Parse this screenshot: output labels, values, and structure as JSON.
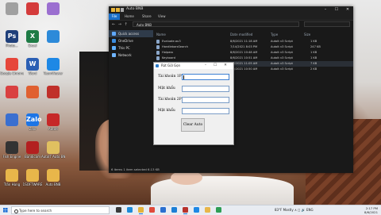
{
  "desktop": {
    "icons": [
      {
        "name": "icon-1",
        "label": "",
        "glyph": "",
        "color": "#a0a0a0"
      },
      {
        "name": "icon-2",
        "label": "",
        "glyph": "",
        "color": "#d43b3b"
      },
      {
        "name": "icon-3",
        "label": "",
        "glyph": "",
        "color": "#9b6fd0"
      },
      {
        "name": "photoshop",
        "label": "Photo...",
        "glyph": "Ps",
        "color": "#1f3f7a"
      },
      {
        "name": "excel",
        "label": "Excel",
        "glyph": "X",
        "color": "#1e7b45"
      },
      {
        "name": "app-blue",
        "label": "",
        "glyph": "",
        "color": "#2d8ad9"
      },
      {
        "name": "chrome",
        "label": "Google Chrome",
        "glyph": "",
        "color": "#e6463a"
      },
      {
        "name": "word",
        "label": "Word",
        "glyph": "W",
        "color": "#2b5fb4"
      },
      {
        "name": "teamviewer",
        "label": "TeamViewer",
        "glyph": "",
        "color": "#1e88e5"
      },
      {
        "name": "app-red-1",
        "label": "",
        "glyph": "",
        "color": "#d94040"
      },
      {
        "name": "app-red-2",
        "label": "",
        "glyph": "",
        "color": "#e06030"
      },
      {
        "name": "app-red-3",
        "label": "",
        "glyph": "",
        "color": "#c0302a"
      },
      {
        "name": "app-4",
        "label": "",
        "glyph": "",
        "color": "#3a6fd0"
      },
      {
        "name": "zalo",
        "label": "Zalo",
        "glyph": "Zalo",
        "color": "#1d75e6"
      },
      {
        "name": "autoit",
        "label": "AutoIt",
        "glyph": "",
        "color": "#c62828"
      },
      {
        "name": "game",
        "label": "Fish Engine",
        "glyph": "",
        "color": "#333"
      },
      {
        "name": "bandicam",
        "label": "Bandicam",
        "glyph": "",
        "color": "#b32020"
      },
      {
        "name": "autoit-folder",
        "label": "AutoIT Auto BNB",
        "glyph": "",
        "color": "#e0c060"
      },
      {
        "name": "folder-1",
        "label": "Trần Hùng",
        "glyph": "",
        "color": "#e8b64a"
      },
      {
        "name": "folder-2",
        "label": "1SOFTWARE",
        "glyph": "",
        "color": "#e8b64a"
      },
      {
        "name": "folder-3",
        "label": "Auto BNB",
        "glyph": "",
        "color": "#e8b64a"
      }
    ]
  },
  "explorer": {
    "title": "Auto BNB",
    "ribbon": [
      "File",
      "Home",
      "Share",
      "View"
    ],
    "path": "Auto BNB",
    "nav_items": [
      {
        "label": "Quick access",
        "color": "#5fa8ff",
        "selected": true
      },
      {
        "label": "OneDrive",
        "color": "#3b8de0",
        "selected": false
      },
      {
        "label": "This PC",
        "color": "#5fb0ff",
        "selected": false
      },
      {
        "label": "Network",
        "color": "#6fb5ff",
        "selected": false
      }
    ],
    "columns": [
      "Name",
      "Date modified",
      "Type",
      "Size"
    ],
    "files": [
      {
        "name": "Evaluate.au3",
        "date": "8/6/2021 11:18 AM",
        "type": "AutoIt v3 Script",
        "size": "1 KB"
      },
      {
        "name": "HandlebarsSearch",
        "date": "7/14/2021 8:03 PM",
        "type": "AutoIt v3 Script",
        "size": "247 KB"
      },
      {
        "name": "Hoipass",
        "date": "8/6/2021 10:48 AM",
        "type": "AutoIt v3 Script",
        "size": "1 KB"
      },
      {
        "name": "Keyboard",
        "date": "8/6/2021 10:51 AM",
        "type": "AutoIt v3 Script",
        "size": "1 KB"
      },
      {
        "name": "Main",
        "date": "8/6/2021 11:05 AM",
        "type": "AutoIt v3 Script",
        "size": "7 KB"
      },
      {
        "name": "Open",
        "date": "8/6/2021 10:50 AM",
        "type": "AutoIt v3 Script",
        "size": "2 KB"
      }
    ],
    "status": "6 items   1 item selected  6.13 KB"
  },
  "dialog": {
    "title": "Rút Gửi Gọn",
    "fields": [
      {
        "label": "Tài khoản 1P"
      },
      {
        "label": "Mật khẩu"
      },
      {
        "label": "Tài khoản 2P"
      },
      {
        "label": "Mật khẩu"
      }
    ],
    "clear_button": "Clear Auto"
  },
  "taskbar": {
    "search_placeholder": "Type here to search",
    "apps": [
      {
        "name": "task-view",
        "color": "#3a3a3a"
      },
      {
        "name": "edge",
        "color": "#1d8ad8"
      },
      {
        "name": "file-explorer",
        "color": "#e3b23c"
      },
      {
        "name": "chrome",
        "color": "#e04a3a"
      },
      {
        "name": "store",
        "color": "#2a6fd0"
      },
      {
        "name": "mail",
        "color": "#1c7fd6"
      },
      {
        "name": "autoit",
        "color": "#b8322c"
      },
      {
        "name": "teamviewer",
        "color": "#1e88e5"
      },
      {
        "name": "explorer-2",
        "color": "#e8b64a"
      },
      {
        "name": "app-green",
        "color": "#2e9e55"
      }
    ],
    "tray_text": "83°F  Mostly  ∧  ◻  🔊  ENG",
    "time": "2:17 PM",
    "date": "8/6/2021"
  }
}
